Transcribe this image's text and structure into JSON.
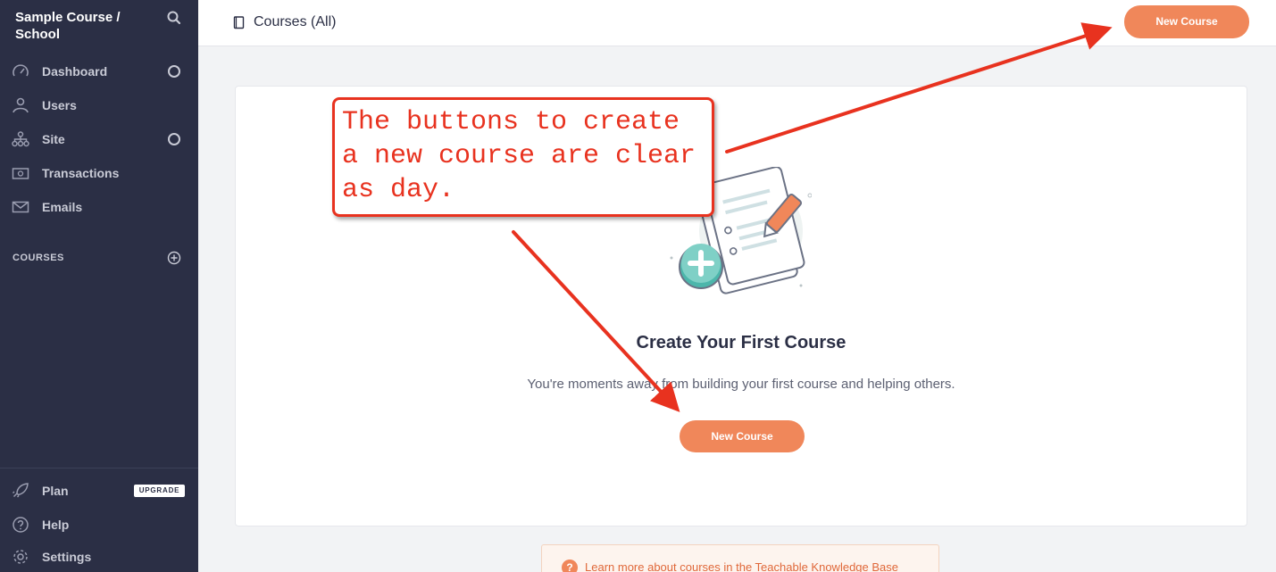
{
  "sidebar": {
    "school_name": "Sample Course / School",
    "items": [
      {
        "label": "Dashboard",
        "icon": "speedometer-icon"
      },
      {
        "label": "Users",
        "icon": "users-icon"
      },
      {
        "label": "Site",
        "icon": "sitemap-icon"
      },
      {
        "label": "Transactions",
        "icon": "money-icon"
      },
      {
        "label": "Emails",
        "icon": "envelope-icon"
      }
    ],
    "courses_heading": "COURSES",
    "bottom_items": [
      {
        "label": "Plan",
        "icon": "rocket-icon"
      },
      {
        "label": "Help",
        "icon": "question-icon"
      },
      {
        "label": "Settings",
        "icon": "gear-icon"
      }
    ],
    "upgrade_badge": "UPGRADE"
  },
  "topbar": {
    "title": "Courses (All)",
    "new_course_label": "New Course"
  },
  "main": {
    "empty_title": "Create Your First Course",
    "empty_subtitle": "You're moments away from building your first course and helping others.",
    "new_course_label": "New Course"
  },
  "kb": {
    "link_text": "Learn more",
    "rest_text": " about courses in the Teachable Knowledge Base"
  },
  "annotation": {
    "text": "The buttons to create a new course are clear as day."
  },
  "colors": {
    "sidebar_bg": "#2b2f45",
    "accent": "#f0875a",
    "annotation_red": "#e8321f"
  }
}
